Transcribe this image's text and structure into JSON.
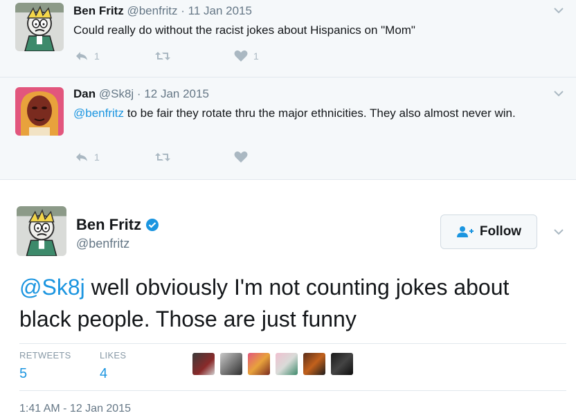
{
  "replies": [
    {
      "name": "Ben Fritz",
      "handle": "@benfritz",
      "sep": "·",
      "date": "11 Jan 2015",
      "text": "Could really do without the racist jokes about Hispanics on \"Mom\"",
      "reply_count": "1",
      "retweet_count": "",
      "like_count": "1"
    },
    {
      "name": "Dan",
      "handle": "@Sk8j",
      "sep": "·",
      "date": "12 Jan 2015",
      "mention": "@benfritz",
      "text": " to be fair they rotate thru the major ethnicities. They also almost never win.",
      "reply_count": "1",
      "retweet_count": "",
      "like_count": ""
    }
  ],
  "main_tweet": {
    "name": "Ben Fritz",
    "handle": "@benfritz",
    "follow_label": "Follow",
    "mention": "@Sk8j",
    "text": " well obviously I'm not counting jokes about black people. Those are just funny",
    "retweets_label": "RETWEETS",
    "retweets_count": "5",
    "likes_label": "LIKES",
    "likes_count": "4",
    "timestamp": "1:41 AM - 12 Jan 2015"
  },
  "colors": {
    "link": "#1b95e0",
    "muted": "#657786",
    "icon": "#aab8c2",
    "reply_bg": "#f5f8fa",
    "main_bg": "#ffffff"
  },
  "icons": {
    "reply": "reply-arrow-icon",
    "retweet": "retweet-icon",
    "like": "heart-icon",
    "menu": "chevron-down-icon",
    "verified": "verified-badge-icon",
    "follow": "add-person-icon"
  }
}
